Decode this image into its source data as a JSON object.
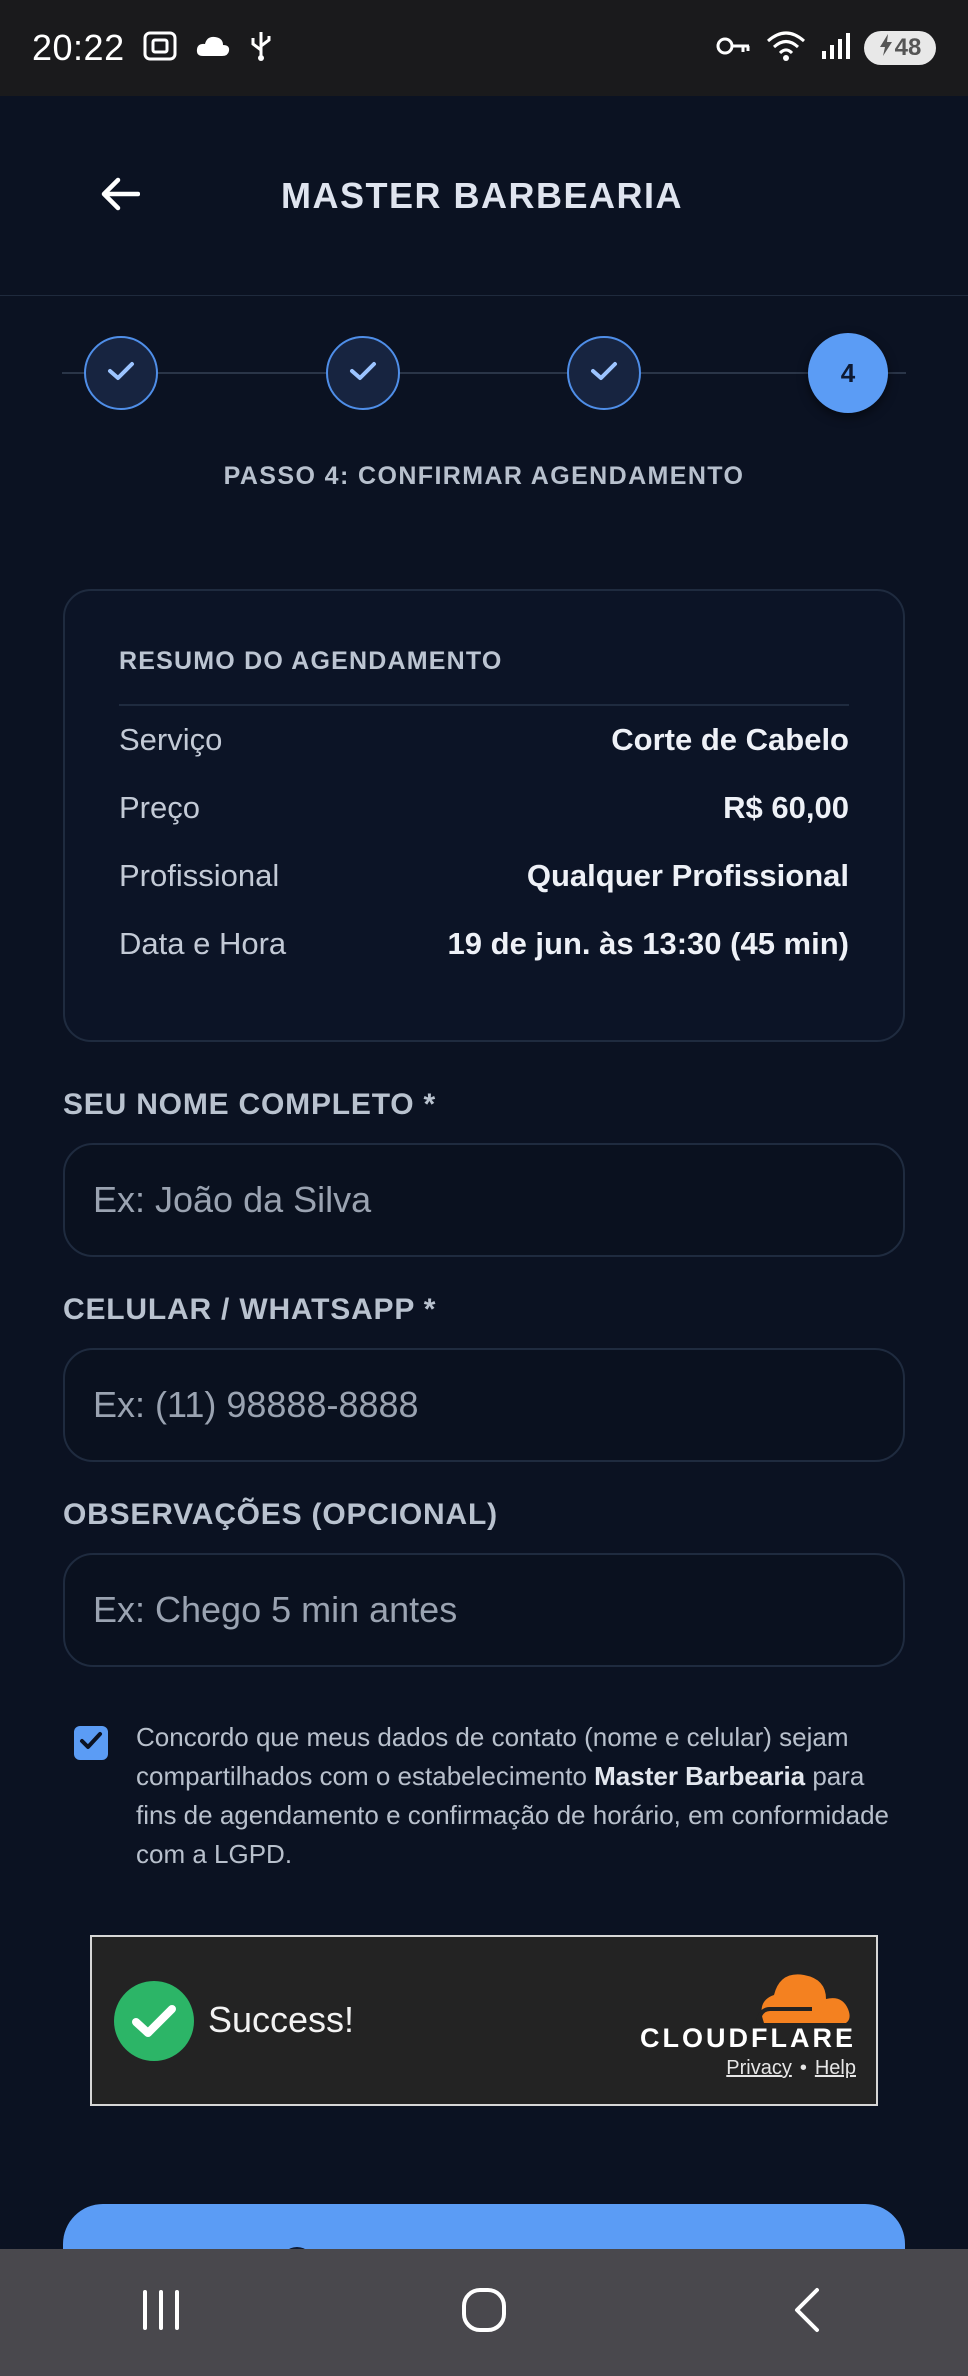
{
  "status_bar": {
    "time": "20:22",
    "battery": "48",
    "icons": [
      "screenshot-icon",
      "cloud-icon",
      "usb-icon",
      "key-icon",
      "wifi-icon",
      "signal-icon",
      "battery-charging-icon"
    ]
  },
  "header": {
    "title": "MASTER BARBEARIA",
    "back_icon": "arrow-left-icon"
  },
  "stepper": {
    "steps": [
      {
        "state": "done"
      },
      {
        "state": "done"
      },
      {
        "state": "done"
      },
      {
        "state": "active",
        "label": "4"
      }
    ],
    "title": "PASSO 4: CONFIRMAR AGENDAMENTO"
  },
  "summary": {
    "heading": "RESUMO DO AGENDAMENTO",
    "rows": [
      {
        "label": "Serviço",
        "value": "Corte de Cabelo"
      },
      {
        "label": "Preço",
        "value": "R$ 60,00"
      },
      {
        "label": "Profissional",
        "value": "Qualquer Profissional"
      },
      {
        "label": "Data e Hora",
        "value": "19 de jun. às 13:30 (45 min)"
      }
    ]
  },
  "form": {
    "name": {
      "label": "SEU NOME COMPLETO *",
      "placeholder": "Ex: João da Silva",
      "value": ""
    },
    "phone": {
      "label": "CELULAR / WHATSAPP *",
      "placeholder": "Ex: (11) 98888-8888",
      "value": ""
    },
    "notes": {
      "label": "OBSERVAÇÕES (OPCIONAL)",
      "placeholder": "Ex: Chego 5 min antes",
      "value": ""
    }
  },
  "consent": {
    "checked": true,
    "text_before": "Concordo que meus dados de contato (nome e celular) sejam compartilhados com o estabelecimento ",
    "business": "Master Barbearia",
    "text_after": " para fins de agendamento e confirmação de horário, em conformidade com a LGPD."
  },
  "turnstile": {
    "status": "Success!",
    "brand": "CLOUDFLARE",
    "privacy": "Privacy",
    "separator": "•",
    "help": "Help"
  },
  "nav": {
    "icons": [
      "recents-icon",
      "home-icon",
      "back-icon"
    ]
  },
  "colors": {
    "background": "#0b1222",
    "accent": "#5b9cf5",
    "success": "#2cb567",
    "cloudflare_orange": "#f48120"
  }
}
